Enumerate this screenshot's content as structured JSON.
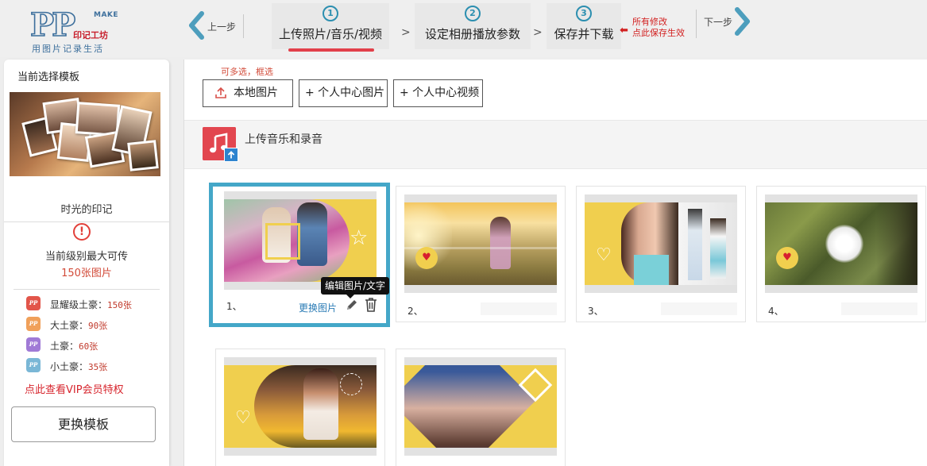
{
  "header": {
    "logo": {
      "mark": "PP",
      "make": "MAKE",
      "brand": "印记工坊",
      "slogan": "用图片记录生活"
    },
    "prev_label": "上一步",
    "next_label": "下一步",
    "steps": [
      {
        "num": "1",
        "label": "上传照片/音乐/视频",
        "active": true
      },
      {
        "num": "2",
        "label": "设定相册播放参数",
        "active": false
      },
      {
        "num": "3",
        "label": "保存并下载",
        "active": false
      }
    ],
    "separator": ">",
    "save_hint": {
      "arrow": "⬅",
      "line1": "所有修改",
      "line2": "点此保存生效"
    }
  },
  "sidebar": {
    "title": "当前选择模板",
    "template_name": "时光的印记",
    "alert_mark": "!",
    "max_label": "当前级别最大可传",
    "max_count": "150张图片",
    "levels": [
      {
        "badge": "PP",
        "name": "显耀级土豪：",
        "limit": "150张",
        "color": "#e2554a"
      },
      {
        "badge": "PP",
        "name": "大土豪：",
        "limit": "90张",
        "color": "#f0a05a"
      },
      {
        "badge": "PP",
        "name": "土豪：",
        "limit": "60张",
        "color": "#a07ad6"
      },
      {
        "badge": "PP",
        "name": "小土豪：",
        "limit": "35张",
        "color": "#7ab7d6"
      }
    ],
    "vip_link": "点此查看VIP会员特权",
    "change_button": "更换模板"
  },
  "main": {
    "hint": "可多选，框选",
    "buttons": {
      "local": "本地图片",
      "center_photos": "+ 个人中心图片",
      "center_videos": "+ 个人中心视频"
    },
    "music_label": "上传音乐和录音",
    "edit_link": "更换图片",
    "tooltip": "编辑图片/文字",
    "cards": [
      {
        "index": "1、"
      },
      {
        "index": "2、"
      },
      {
        "index": "3、"
      },
      {
        "index": "4、"
      },
      {
        "index": ""
      },
      {
        "index": ""
      }
    ]
  },
  "colors": {
    "accent_blue": "#44a7c8",
    "step_blue": "#2c8fb0",
    "active_red": "#e2404a",
    "warning_red": "#d21f1f",
    "template_yellow": "#f0cf4e"
  }
}
